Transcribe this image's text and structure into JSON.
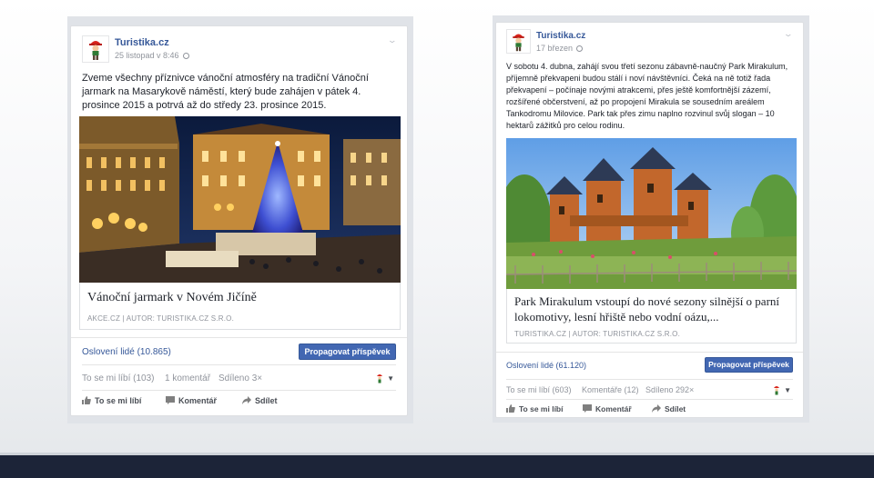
{
  "posts": [
    {
      "page_name": "Turistika.cz",
      "date": "25 listopad v 8:46",
      "text": "Zveme všechny příznivce vánoční atmosféry na tradiční Vánoční jarmark na Masarykově náměstí, který bude zahájen v pátek 4. prosince 2015 a potrvá až do středy 23. prosince 2015.",
      "link_title": "Vánoční jarmark v Novém Jičíně",
      "link_source": "AKCE.CZ | AUTOR: TURISTIKA.CZ S.R.O.",
      "reach": "Oslovení lidé (10.865)",
      "promote_label": "Propagovat příspěvek",
      "stats": {
        "likes": "To se mi líbí (103)",
        "comments": "1 komentář",
        "shares": "Sdíleno 3×"
      },
      "actions": {
        "like": "To se mi líbí",
        "comment": "Komentář",
        "share": "Sdílet"
      }
    },
    {
      "page_name": "Turistika.cz",
      "date": "17 březen",
      "text": "V sobotu 4. dubna, zahájí svou třetí sezonu zábavně-naučný Park Mirakulum, příjemně překvapeni budou stálí i noví návštěvníci. Čeká na ně totiž řada překvapení – počínaje novými atrakcemi, přes ještě komfortnější zázemí, rozšířené občerstvení, až po propojení Mirakula se sousedním areálem Tankodromu Milovice. Park tak přes zimu naplno rozvinul svůj slogan – 10 hektarů zážitků pro celou rodinu.",
      "link_title": "Park Mirakulum vstoupí do nové sezony silnější o parní lokomotivy, lesní hřiště nebo vodní oázu,...",
      "link_source": "TURISTIKA.CZ | AUTOR: TURISTIKA.CZ S.R.O.",
      "reach": "Oslovení lidé (61.120)",
      "promote_label": "Propagovat příspěvek",
      "stats": {
        "likes": "To se mi líbí (603)",
        "comments": "Komentáře (12)",
        "shares": "Sdíleno 292×"
      },
      "actions": {
        "like": "To se mi líbí",
        "comment": "Komentář",
        "share": "Sdílet"
      }
    }
  ],
  "colors": {
    "link_blue": "#365899",
    "button_blue": "#4267b2",
    "bottom_bar": "#1c2438"
  },
  "icons": [
    "globe-icon",
    "chevron-down-icon",
    "like-icon",
    "comment-icon",
    "share-icon"
  ]
}
